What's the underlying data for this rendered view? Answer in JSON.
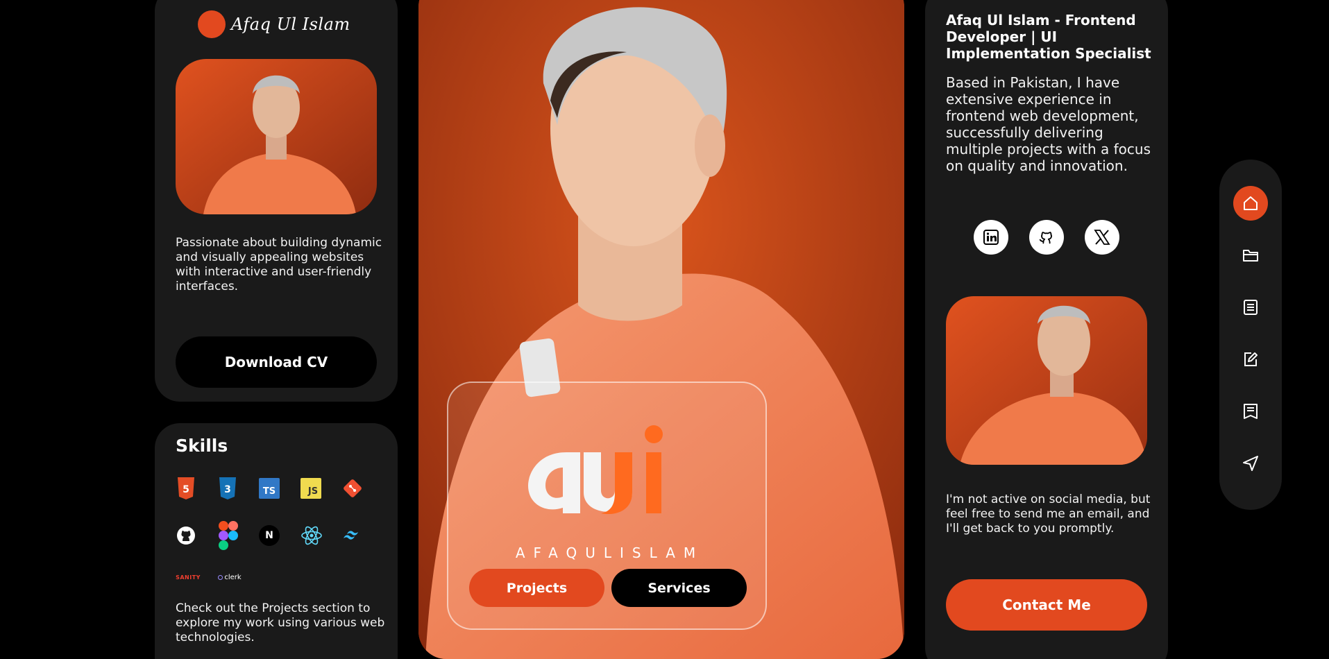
{
  "brand": {
    "name": "Afaq Ul Islam",
    "wordmark": "AFAQULISLAM",
    "accent": "#e2491f"
  },
  "profile": {
    "bio": "Passionate about building dynamic and visually appealing websites with interactive and user-friendly interfaces.",
    "cv_button": "Download CV"
  },
  "skills": {
    "title": "Skills",
    "icons": [
      "html5-icon",
      "css3-icon",
      "typescript-icon",
      "javascript-icon",
      "git-icon",
      "github-icon",
      "figma-icon",
      "nextjs-icon",
      "react-icon",
      "tailwind-icon",
      "sanity-icon",
      "clerk-icon"
    ],
    "labels": {
      "ts": "TS",
      "js": "JS",
      "next": "N",
      "sanity": "SANITY",
      "clerk": "clerk"
    },
    "note": "Check out the Projects section to explore my work using various web technologies."
  },
  "hero": {
    "buttons": {
      "projects": "Projects",
      "services": "Services"
    }
  },
  "about": {
    "title_name": "Afaq Ul Islam - ",
    "title_role": "Frontend Developer | UI Implementation Specialist",
    "body": "Based in Pakistan, I have extensive experience in frontend web development, successfully delivering multiple projects with a focus on quality and innovation.",
    "social": [
      "linkedin-icon",
      "github-icon",
      "x-icon"
    ],
    "note": "I'm not active on social media, but feel free to send me an email, and I'll get back to you promptly.",
    "contact_button": "Contact Me"
  },
  "nav": {
    "items": [
      "home-icon",
      "folder-icon",
      "resume-icon",
      "edit-icon",
      "blog-icon",
      "send-icon"
    ],
    "active": "home-icon"
  }
}
